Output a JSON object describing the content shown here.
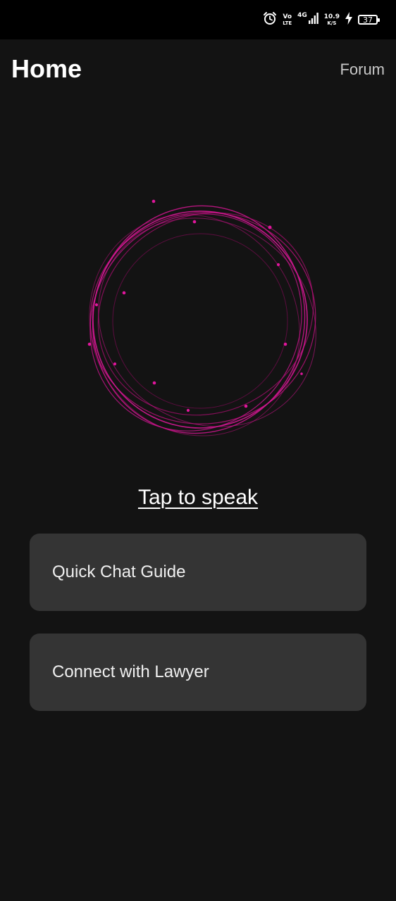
{
  "status_bar": {
    "volte_top": "Vo",
    "volte_bottom": "LTE",
    "network_type": "4G",
    "speed_value": "10.9",
    "speed_unit": "K/S",
    "battery_level": "37",
    "icons": [
      "alarm-icon",
      "signal-icon",
      "charging-icon",
      "battery-icon"
    ]
  },
  "header": {
    "title": "Home",
    "forum_label": "Forum"
  },
  "voice": {
    "orb_icon": "voice-orb-icon",
    "accent_color": "#e0169c",
    "tap_label": "Tap to speak"
  },
  "actions": [
    {
      "label": "Quick Chat Guide"
    },
    {
      "label": "Connect with Lawyer"
    }
  ],
  "colors": {
    "background": "#131313",
    "card": "#343434",
    "status_bar": "#000000"
  }
}
